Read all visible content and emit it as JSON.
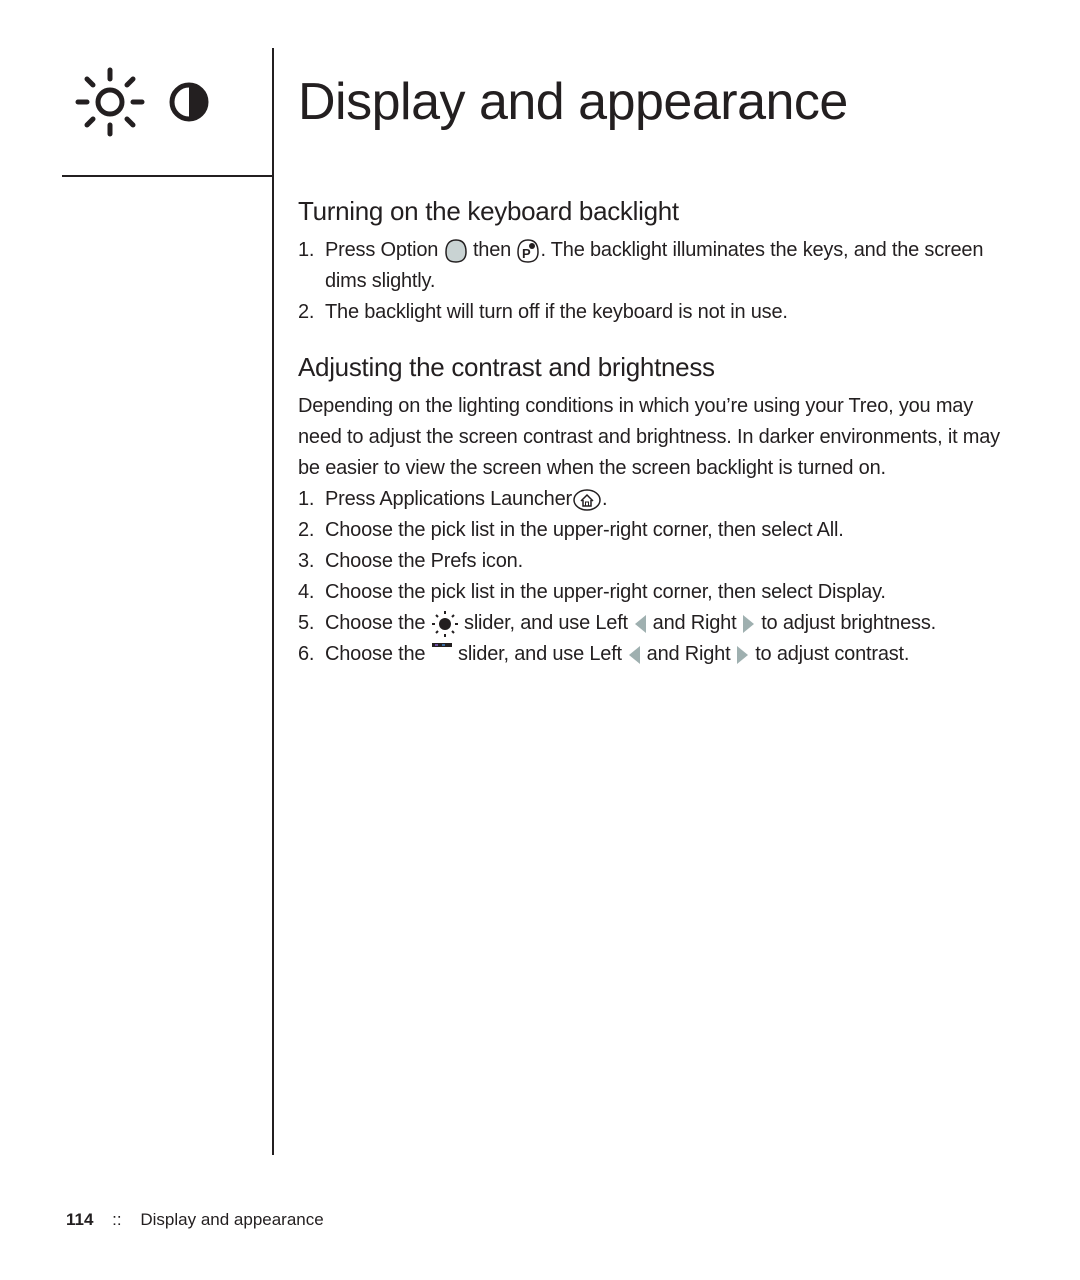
{
  "page": {
    "title": "Display and appearance",
    "chapter_icons": [
      "sun-brightness-icon",
      "contrast-icon"
    ]
  },
  "sections": [
    {
      "heading": "Turning on the keyboard backlight",
      "steps": [
        {
          "num": "1.",
          "text_a": "Press Option",
          "text_b": "then",
          "text_c": ". The backlight illuminates the keys, and the screen dims slightly."
        },
        {
          "num": "2.",
          "text": "The backlight will turn off if the keyboard is not in use."
        }
      ]
    },
    {
      "heading": "Adjusting the contrast and brightness",
      "intro": "Depending on the lighting conditions in which you’re using your Treo, you may need to adjust the screen contrast and brightness. In darker environments, it may be easier to view the screen when the screen backlight is turned on.",
      "steps": [
        {
          "num": "1.",
          "text_a": "Press Applications Launcher",
          "text_b": "."
        },
        {
          "num": "2.",
          "text": "Choose the pick list in the upper-right corner, then select All."
        },
        {
          "num": "3.",
          "text": "Choose the Prefs icon."
        },
        {
          "num": "4.",
          "text": "Choose the pick list in the upper-right corner, then select Display."
        },
        {
          "num": "5.",
          "text_a": "Choose the",
          "text_b": "slider, and use Left",
          "text_c": "and Right",
          "text_d": "to adjust brightness."
        },
        {
          "num": "6.",
          "text_a": "Choose the",
          "text_b": "slider, and use Left",
          "text_c": "and Right",
          "text_d": "to adjust contrast."
        }
      ]
    }
  ],
  "footer": {
    "page_number": "114",
    "separator": "::",
    "chapter": "Display and appearance"
  },
  "colors": {
    "text": "#231f20",
    "key_fill": "#c9d3d3",
    "arrow_fill": "#9fb0b0"
  }
}
